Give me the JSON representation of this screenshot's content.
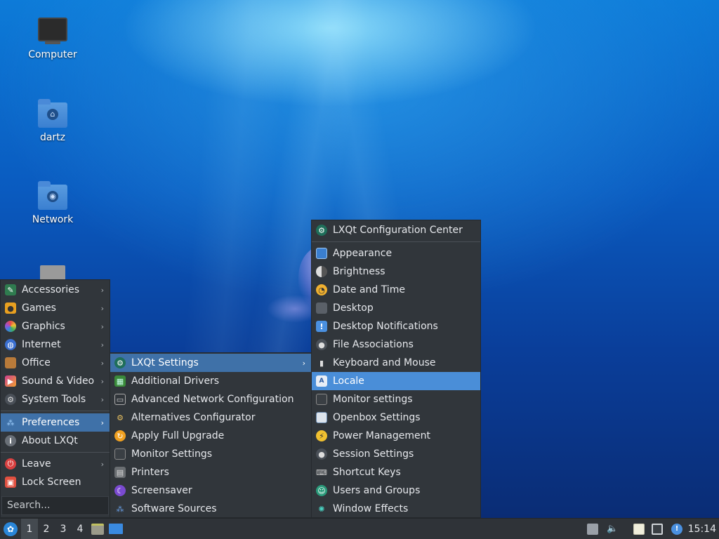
{
  "desktop": {
    "icons": [
      {
        "label": "Computer",
        "icon": "computer-icon"
      },
      {
        "label": "dartz",
        "icon": "home-folder-icon"
      },
      {
        "label": "Network",
        "icon": "network-folder-icon"
      },
      {
        "label": "",
        "icon": "trash-icon"
      }
    ]
  },
  "main_menu": {
    "categories": [
      {
        "label": "Accessories",
        "icon": "accessories-icon",
        "has_submenu": true
      },
      {
        "label": "Games",
        "icon": "games-icon",
        "has_submenu": true
      },
      {
        "label": "Graphics",
        "icon": "graphics-icon",
        "has_submenu": true
      },
      {
        "label": "Internet",
        "icon": "internet-icon",
        "has_submenu": true
      },
      {
        "label": "Office",
        "icon": "office-icon",
        "has_submenu": true
      },
      {
        "label": "Sound & Video",
        "icon": "sound-video-icon",
        "has_submenu": true
      },
      {
        "label": "System Tools",
        "icon": "system-tools-icon",
        "has_submenu": true
      }
    ],
    "preferences": {
      "label": "Preferences",
      "icon": "preferences-icon"
    },
    "about": {
      "label": "About LXQt",
      "icon": "info-icon"
    },
    "leave": {
      "label": "Leave",
      "icon": "power-icon"
    },
    "lock": {
      "label": "Lock Screen",
      "icon": "lock-icon"
    },
    "search_placeholder": "Search..."
  },
  "preferences_menu": {
    "items": [
      {
        "label": "LXQt Settings",
        "icon": "lxqt-settings-icon"
      },
      {
        "label": "Additional Drivers",
        "icon": "drivers-icon"
      },
      {
        "label": "Advanced Network Configuration",
        "icon": "network-config-icon"
      },
      {
        "label": "Alternatives Configurator",
        "icon": "alternatives-icon"
      },
      {
        "label": "Apply Full Upgrade",
        "icon": "upgrade-icon"
      },
      {
        "label": "Monitor Settings",
        "icon": "monitor-icon"
      },
      {
        "label": "Printers",
        "icon": "printer-icon"
      },
      {
        "label": "Screensaver",
        "icon": "screensaver-icon"
      },
      {
        "label": "Software Sources",
        "icon": "software-sources-icon"
      }
    ]
  },
  "lxqt_settings_menu": {
    "header": {
      "label": "LXQt Configuration Center",
      "icon": "config-center-icon"
    },
    "items": [
      {
        "label": "Appearance",
        "icon": "appearance-icon"
      },
      {
        "label": "Brightness",
        "icon": "brightness-icon"
      },
      {
        "label": "Date and Time",
        "icon": "clock-icon"
      },
      {
        "label": "Desktop",
        "icon": "desktop-icon"
      },
      {
        "label": "Desktop Notifications",
        "icon": "notifications-icon"
      },
      {
        "label": "File Associations",
        "icon": "file-associations-icon"
      },
      {
        "label": "Keyboard and Mouse",
        "icon": "keyboard-mouse-icon"
      },
      {
        "label": "Locale",
        "icon": "locale-icon"
      },
      {
        "label": "Monitor settings",
        "icon": "monitor-settings-icon"
      },
      {
        "label": "Openbox Settings",
        "icon": "openbox-icon"
      },
      {
        "label": "Power Management",
        "icon": "power-management-icon"
      },
      {
        "label": "Session Settings",
        "icon": "session-icon"
      },
      {
        "label": "Shortcut Keys",
        "icon": "keyboard-icon"
      },
      {
        "label": "Users and Groups",
        "icon": "users-icon"
      },
      {
        "label": "Window Effects",
        "icon": "window-effects-icon"
      }
    ]
  },
  "taskbar": {
    "desktops": [
      "1",
      "2",
      "3",
      "4"
    ],
    "clock": "15:14"
  }
}
